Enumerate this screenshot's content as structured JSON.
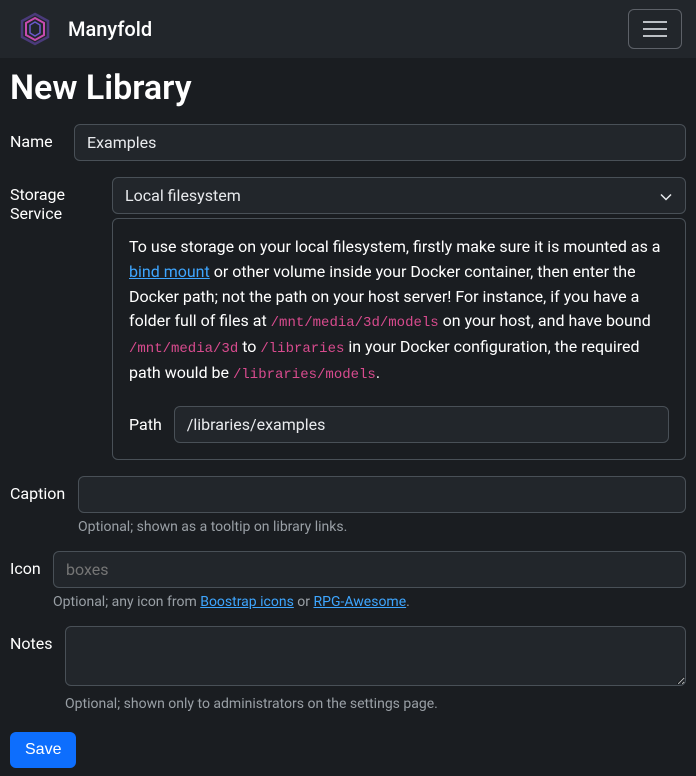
{
  "navbar": {
    "brand": "Manyfold"
  },
  "page": {
    "title": "New Library"
  },
  "form": {
    "name": {
      "label": "Name",
      "value": "Examples"
    },
    "storage": {
      "label": "Storage Service",
      "selected": "Local filesystem",
      "help": {
        "text1": "To use storage on your local filesystem, firstly make sure it is mounted as a ",
        "link1": "bind mount",
        "text2": " or other volume inside your Docker container, then enter the Docker path; not the path on your host server! For instance, if you have a folder full of files at ",
        "code1": "/mnt/media/3d/models",
        "text3": " on your host, and have bound ",
        "code2": "/mnt/media/3d",
        "text4": " to ",
        "code3": "/libraries",
        "text5": " in your Docker configuration, the required path would be ",
        "code4": "/libraries/models",
        "text6": "."
      },
      "path": {
        "label": "Path",
        "value": "/libraries/examples"
      }
    },
    "caption": {
      "label": "Caption",
      "value": "",
      "hint": "Optional; shown as a tooltip on library links."
    },
    "icon": {
      "label": "Icon",
      "value": "",
      "placeholder": "boxes",
      "hint_prefix": "Optional; any icon from ",
      "hint_link1": "Boostrap icons",
      "hint_mid": " or ",
      "hint_link2": "RPG-Awesome",
      "hint_suffix": "."
    },
    "notes": {
      "label": "Notes",
      "value": "",
      "hint": "Optional; shown only to administrators on the settings page."
    },
    "save": "Save"
  }
}
